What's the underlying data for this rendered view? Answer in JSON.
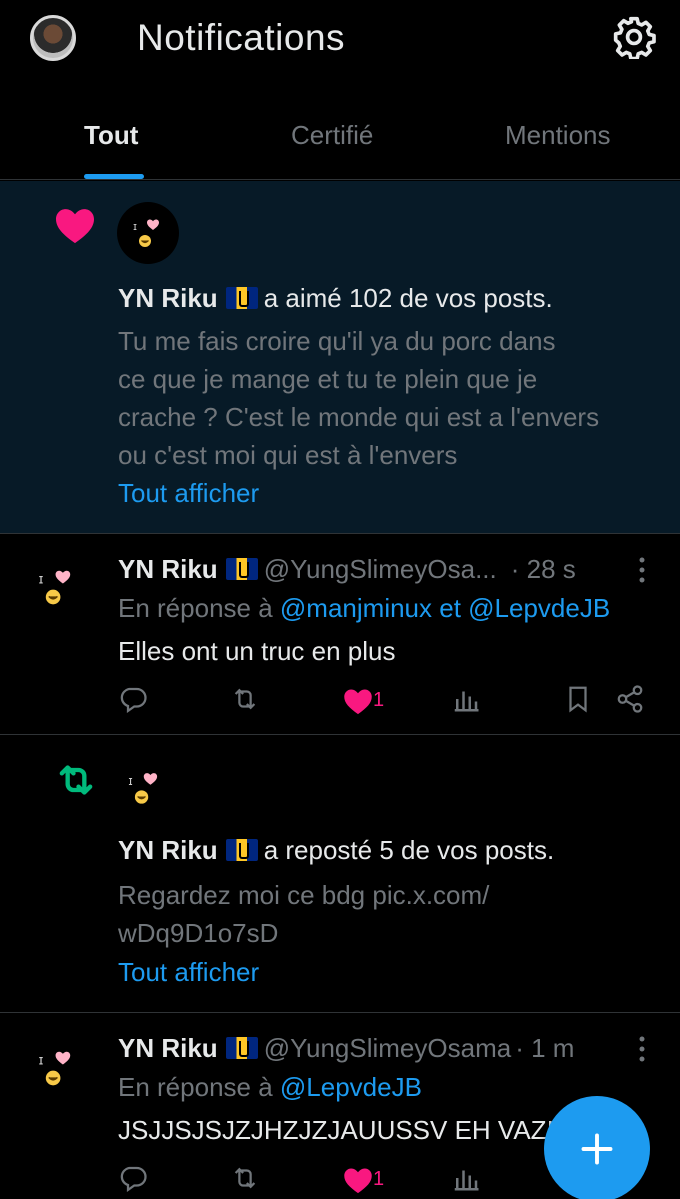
{
  "header": {
    "title": "Notifications",
    "avatar": "user-avatar",
    "settings_icon": "gear-icon"
  },
  "tabs": [
    {
      "label": "Tout",
      "active": true
    },
    {
      "label": "Certifié",
      "active": false
    },
    {
      "label": "Mentions",
      "active": false
    }
  ],
  "notifications": [
    {
      "type": "like",
      "icon": "heart-icon",
      "user": "YN Riku",
      "action_text": "a aimé 102 de vos posts.",
      "post_lines": [
        "Tu me fais croire qu'il ya du porc dans",
        "ce que je mange et tu te plein que je",
        "crache ? C'est le monde qui est a l'envers",
        "ou c'est moi qui est à l'envers"
      ],
      "show_more": "Tout afficher"
    },
    {
      "type": "reply",
      "user": "YN Riku",
      "handle": "@YungSlimeyOsa...",
      "time": "· 28 s",
      "reply_prefix": "En réponse à",
      "reply_to": "@manjminux et @LepvdeJB",
      "text": "Elles ont un truc en plus",
      "like_count": "1"
    },
    {
      "type": "repost",
      "icon": "repost-icon",
      "user": "YN Riku",
      "action_text": "a reposté 5 de vos posts.",
      "post_lines": [
        "Regardez moi ce bdg pic.x.com/",
        "wDq9D1o7sD"
      ],
      "show_more": "Tout afficher"
    },
    {
      "type": "reply",
      "user": "YN Riku",
      "handle": "@YungSlimeyOsama",
      "time": "· 1 m",
      "reply_prefix": "En réponse à",
      "reply_to": "@LepvdeJB",
      "text": "JSJJSJSJZJHZJZJAUUSSV EH VAZI",
      "like_count": "1"
    }
  ],
  "fab": {
    "icon": "plus-icon"
  },
  "colors": {
    "accent": "#1d9bf0",
    "like": "#f91880",
    "repost": "#00ba7c",
    "highlight_bg": "#071a27"
  }
}
